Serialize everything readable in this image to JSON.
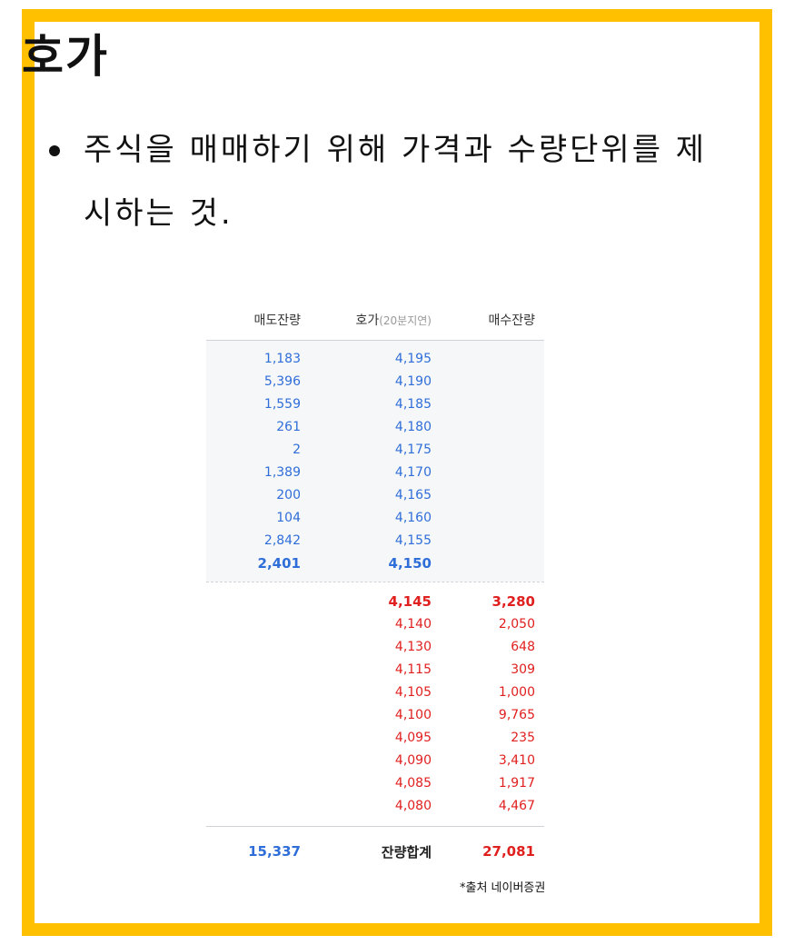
{
  "title": "호가",
  "bullet": "주식을 매매하기 위해 가격과 수량단위를 제시하는 것.",
  "orderbook": {
    "headers": {
      "sell": "매도잔량",
      "price": "호가",
      "price_note": "(20분지연)",
      "buy": "매수잔량"
    },
    "asks": [
      {
        "qty": "1,183",
        "price": "4,195"
      },
      {
        "qty": "5,396",
        "price": "4,190"
      },
      {
        "qty": "1,559",
        "price": "4,185"
      },
      {
        "qty": "261",
        "price": "4,180"
      },
      {
        "qty": "2",
        "price": "4,175"
      },
      {
        "qty": "1,389",
        "price": "4,170"
      },
      {
        "qty": "200",
        "price": "4,165"
      },
      {
        "qty": "104",
        "price": "4,160"
      },
      {
        "qty": "2,842",
        "price": "4,155"
      },
      {
        "qty": "2,401",
        "price": "4,150"
      }
    ],
    "bids": [
      {
        "price": "4,145",
        "qty": "3,280"
      },
      {
        "price": "4,140",
        "qty": "2,050"
      },
      {
        "price": "4,130",
        "qty": "648"
      },
      {
        "price": "4,115",
        "qty": "309"
      },
      {
        "price": "4,105",
        "qty": "1,000"
      },
      {
        "price": "4,100",
        "qty": "9,765"
      },
      {
        "price": "4,095",
        "qty": "235"
      },
      {
        "price": "4,090",
        "qty": "3,410"
      },
      {
        "price": "4,085",
        "qty": "1,917"
      },
      {
        "price": "4,080",
        "qty": "4,467"
      }
    ],
    "total": {
      "sell": "15,337",
      "label": "잔량합계",
      "buy": "27,081"
    }
  },
  "source": "*출처 네이버증권",
  "colors": {
    "frame": "#FFC000",
    "ask": "#2f6ed9",
    "bid": "#e0201f"
  }
}
